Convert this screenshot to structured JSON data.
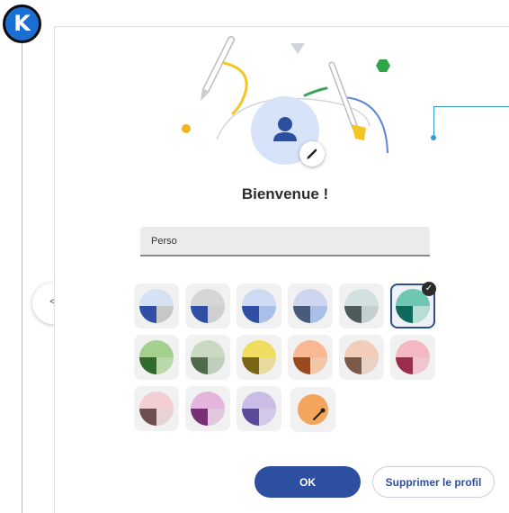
{
  "badge": {
    "letter": "K",
    "color": "#1b6fd3"
  },
  "nav": {
    "glyph": "<"
  },
  "dialog": {
    "title": "Bienvenue !",
    "name_input": {
      "value": "Perso",
      "placeholder": ""
    },
    "avatar_icon": "person-icon",
    "edit_icon": "pencil-icon",
    "themes": [
      {
        "id": "blue-grey",
        "bg": "#d5e1f5",
        "dark": "#2f4fa5",
        "light": "#c7c7c7"
      },
      {
        "id": "grey-blue",
        "bg": "#d6d6d6",
        "dark": "#2f4fa5",
        "light": "#cfcfcf"
      },
      {
        "id": "blue-light",
        "bg": "#cfdaf3",
        "dark": "#2f4fa5",
        "light": "#a9bfe8"
      },
      {
        "id": "blue-slate",
        "bg": "#cdd6ee",
        "dark": "#4a5a7a",
        "light": "#a9bfe8"
      },
      {
        "id": "slate-grey",
        "bg": "#d3e0e0",
        "dark": "#4d5b5a",
        "light": "#c4cfcf"
      },
      {
        "id": "teal",
        "bg": "#6fc7b3",
        "dark": "#0d6a5c",
        "light": "#b7ddd5",
        "selected": true
      },
      {
        "id": "green",
        "bg": "#a4d08e",
        "dark": "#2f6b2b",
        "light": "#b9d9aa"
      },
      {
        "id": "sage",
        "bg": "#c9d9c2",
        "dark": "#4f6a4c",
        "light": "#c0cfbb"
      },
      {
        "id": "yellow",
        "bg": "#f0dc5f",
        "dark": "#7a6416",
        "light": "#e8d9a0"
      },
      {
        "id": "peach",
        "bg": "#f7b892",
        "dark": "#9a4a1e",
        "light": "#f1c7aa"
      },
      {
        "id": "sand",
        "bg": "#f2cdb9",
        "dark": "#7b5a4a",
        "light": "#e6d2c6"
      },
      {
        "id": "pink",
        "bg": "#f3b8c2",
        "dark": "#9a2f4d",
        "light": "#efc6cd"
      },
      {
        "id": "rose",
        "bg": "#f3cfd3",
        "dark": "#6e4f4f",
        "light": "#e7d2d4"
      },
      {
        "id": "magenta",
        "bg": "#e5b6dc",
        "dark": "#7a2f75",
        "light": "#e0c8dd"
      },
      {
        "id": "lavender",
        "bg": "#cbbde6",
        "dark": "#5a4a9a",
        "light": "#d2c8e8"
      }
    ],
    "custom_picker_icon": "eyedropper-icon",
    "ok_label": "OK",
    "delete_label": "Supprimer le profil"
  }
}
